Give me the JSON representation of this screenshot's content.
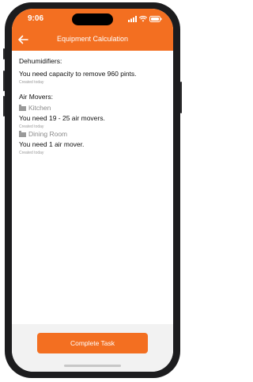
{
  "status_bar": {
    "time": "9:06"
  },
  "nav": {
    "title": "Equipment Calculation",
    "back_icon": "arrow-left-icon"
  },
  "dehumidifiers": {
    "heading": "Dehumidifiers:",
    "message": "You need capacity to remove 960 pints.",
    "meta": "Created today"
  },
  "air_movers": {
    "heading": "Air Movers:",
    "rooms": [
      {
        "name": "Kitchen",
        "message": "You need 19 - 25 air movers.",
        "meta": "Created today"
      },
      {
        "name": "Dining Room",
        "message": "You need 1 air mover.",
        "meta": "Created today"
      }
    ]
  },
  "footer": {
    "button_label": "Complete Task"
  },
  "colors": {
    "brand": "#f36f21",
    "footer_bg": "#f2f2f2"
  }
}
